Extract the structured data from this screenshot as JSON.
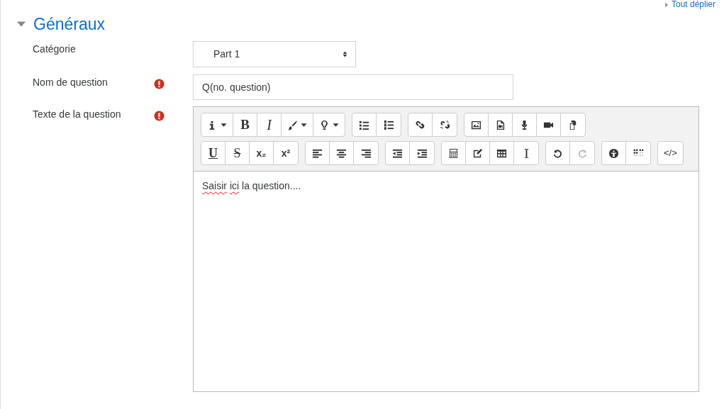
{
  "expand_all_link": "Tout déplier",
  "section": {
    "title": "Généraux",
    "expanded": true
  },
  "fields": [
    {
      "kind": "select",
      "label": "Catégorie",
      "required": false,
      "value": "Part 1"
    },
    {
      "kind": "text",
      "label": "Nom de question",
      "required": true,
      "value": "Q(no. question)"
    },
    {
      "kind": "editor",
      "label": "Texte de la question",
      "required": true,
      "runs": [
        {
          "text": "Saisir",
          "misspelled": true
        },
        {
          "text": "ici",
          "misspelled": true
        },
        {
          "text": "la question....",
          "misspelled": false
        }
      ]
    }
  ],
  "toolbar_rows": [
    [
      [
        {
          "kind": "icon",
          "menu": true,
          "disabled": false
        },
        {
          "kind": "text",
          "label": "B",
          "menu": false,
          "disabled": false
        },
        {
          "kind": "text",
          "label": "I",
          "menu": false,
          "disabled": false
        },
        {
          "kind": "icon",
          "menu": true,
          "disabled": false
        },
        {
          "kind": "icon",
          "menu": true,
          "disabled": false
        }
      ],
      [
        {
          "kind": "icon",
          "menu": false,
          "disabled": false
        },
        {
          "kind": "icon",
          "menu": false,
          "disabled": false
        }
      ],
      [
        {
          "kind": "icon",
          "menu": false,
          "disabled": false
        },
        {
          "kind": "icon",
          "menu": false,
          "disabled": false
        }
      ],
      [
        {
          "kind": "icon",
          "menu": false,
          "disabled": false
        },
        {
          "kind": "icon",
          "menu": false,
          "disabled": false
        },
        {
          "kind": "icon",
          "menu": false,
          "disabled": false
        },
        {
          "kind": "icon",
          "menu": false,
          "disabled": false
        },
        {
          "kind": "icon",
          "menu": false,
          "disabled": false
        }
      ]
    ],
    [
      [
        {
          "kind": "text",
          "label": "U",
          "menu": false,
          "disabled": false
        },
        {
          "kind": "text",
          "label": "S",
          "menu": false,
          "disabled": false
        },
        {
          "kind": "text",
          "label": "x₂",
          "menu": false,
          "disabled": false
        },
        {
          "kind": "text",
          "label": "x²",
          "menu": false,
          "disabled": false
        }
      ],
      [
        {
          "kind": "icon",
          "menu": false,
          "disabled": false
        },
        {
          "kind": "icon",
          "menu": false,
          "disabled": false
        },
        {
          "kind": "icon",
          "menu": false,
          "disabled": false
        }
      ],
      [
        {
          "kind": "icon",
          "menu": false,
          "disabled": false
        },
        {
          "kind": "icon",
          "menu": false,
          "disabled": false
        }
      ],
      [
        {
          "kind": "icon",
          "menu": false,
          "disabled": false
        },
        {
          "kind": "icon",
          "menu": false,
          "disabled": false
        },
        {
          "kind": "icon",
          "menu": false,
          "disabled": false
        },
        {
          "kind": "icon",
          "menu": false,
          "disabled": false
        }
      ],
      [
        {
          "kind": "icon",
          "menu": false,
          "disabled": false
        },
        {
          "kind": "icon",
          "menu": false,
          "disabled": true
        }
      ],
      [
        {
          "kind": "icon",
          "menu": false,
          "disabled": false
        },
        {
          "kind": "icon",
          "menu": false,
          "disabled": false
        }
      ],
      [
        {
          "kind": "text",
          "label": "</>",
          "menu": false,
          "disabled": false
        }
      ]
    ]
  ]
}
